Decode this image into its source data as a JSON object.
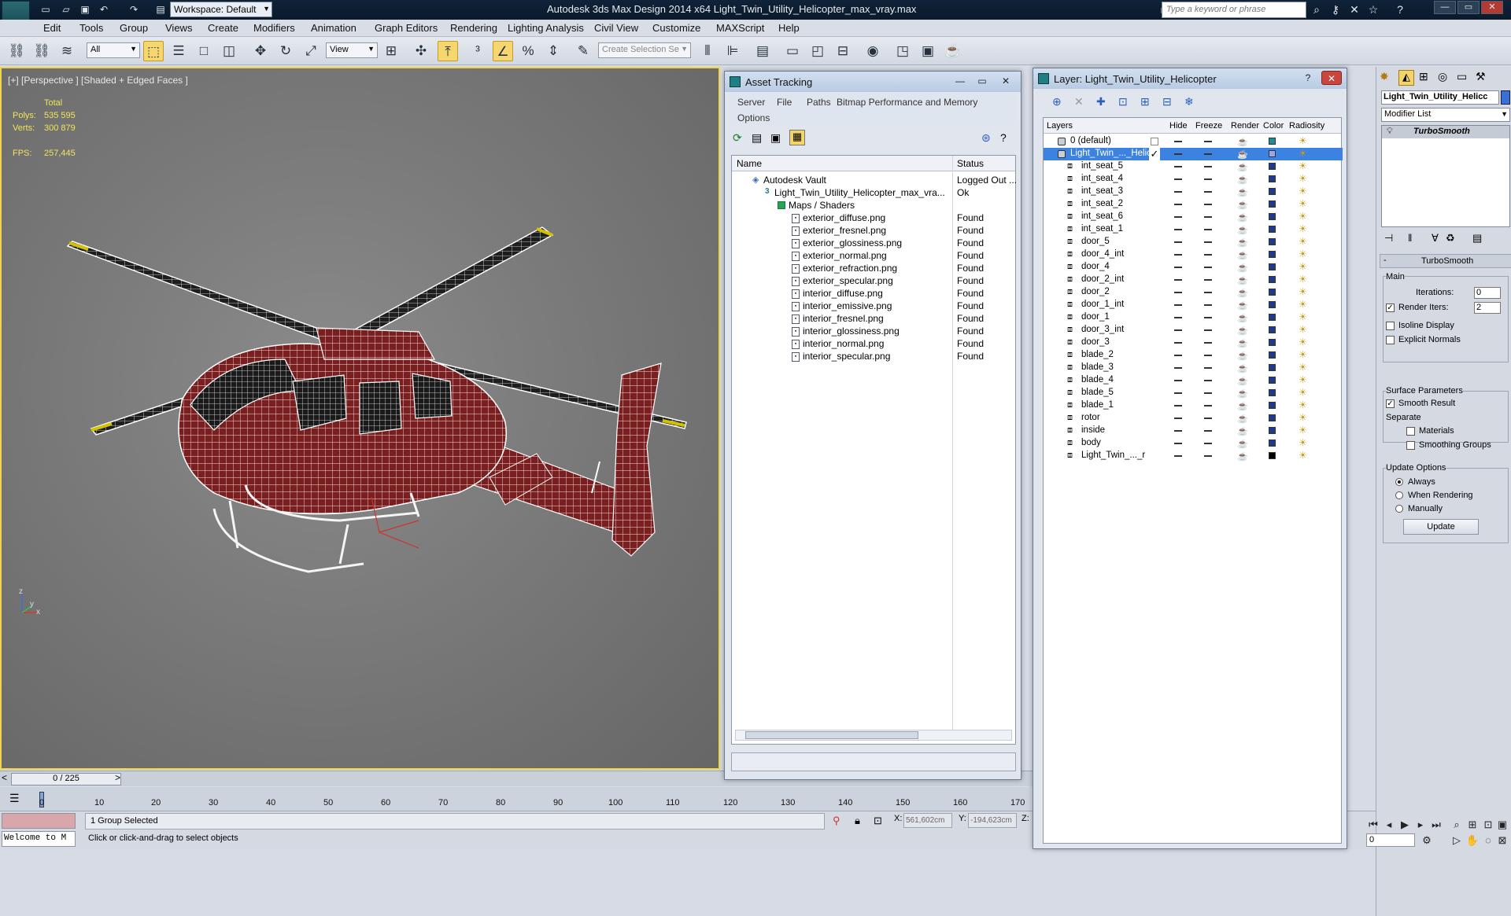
{
  "titlebar": {
    "logo_text": "MXD",
    "workspace": "Workspace: Default",
    "app_title": "Autodesk 3ds Max Design 2014 x64     Light_Twin_Utility_Helicopter_max_vray.max",
    "search_placeholder": "Type a keyword or phrase"
  },
  "menu": [
    "Edit",
    "Tools",
    "Group",
    "Views",
    "Create",
    "Modifiers",
    "Animation",
    "Graph Editors",
    "Rendering",
    "Lighting Analysis",
    "Civil View",
    "Customize",
    "MAXScript",
    "Help"
  ],
  "toolbar": {
    "filter": "All",
    "ref_coord": "View",
    "selection_set_placeholder": "Create Selection Se"
  },
  "viewport": {
    "label": "[+] [Perspective ] [Shaded + Edged Faces ]",
    "stats_header": "Total",
    "polys_label": "Polys:",
    "polys_value": "535 595",
    "verts_label": "Verts:",
    "verts_value": "300 879",
    "fps_label": "FPS:",
    "fps_value": "257,445",
    "axis_z": "z",
    "axis_x": "x",
    "axis_y": "y"
  },
  "timeline": {
    "frame": "0 / 225",
    "ticks": [
      "0",
      "10",
      "20",
      "30",
      "40",
      "50",
      "60",
      "70",
      "80",
      "90",
      "100",
      "110",
      "120",
      "130",
      "140",
      "150",
      "160",
      "170"
    ]
  },
  "status": {
    "listener_text": "Welcome to M",
    "selected": "1 Group Selected",
    "prompt": "Click or click-and-drag to select objects",
    "x_label": "X:",
    "x_value": "561,602cm",
    "y_label": "Y:",
    "y_value": "-194,623cm",
    "z_label": "Z:",
    "frame_input": "0"
  },
  "asset_tracking": {
    "title": "Asset Tracking",
    "menu": [
      "Server",
      "File",
      "Paths",
      "Bitmap Performance and Memory",
      "Options"
    ],
    "col_name": "Name",
    "col_status": "Status",
    "vault": {
      "name": "Autodesk Vault",
      "status": "Logged Out ..."
    },
    "scene_file": {
      "name": "Light_Twin_Utility_Helicopter_max_vra...",
      "status": "Ok"
    },
    "maps_folder": "Maps / Shaders",
    "files": [
      {
        "name": "exterior_diffuse.png",
        "status": "Found"
      },
      {
        "name": "exterior_fresnel.png",
        "status": "Found"
      },
      {
        "name": "exterior_glossiness.png",
        "status": "Found"
      },
      {
        "name": "exterior_normal.png",
        "status": "Found"
      },
      {
        "name": "exterior_refraction.png",
        "status": "Found"
      },
      {
        "name": "exterior_specular.png",
        "status": "Found"
      },
      {
        "name": "interior_diffuse.png",
        "status": "Found"
      },
      {
        "name": "interior_emissive.png",
        "status": "Found"
      },
      {
        "name": "interior_fresnel.png",
        "status": "Found"
      },
      {
        "name": "interior_glossiness.png",
        "status": "Found"
      },
      {
        "name": "interior_normal.png",
        "status": "Found"
      },
      {
        "name": "interior_specular.png",
        "status": "Found"
      }
    ]
  },
  "layers": {
    "title": "Layer: Light_Twin_Utility_Helicopter",
    "columns": [
      "Layers",
      "Hide",
      "Freeze",
      "Render",
      "Color",
      "Radiosity"
    ],
    "default_layer": "0 (default)",
    "active_layer": "Light_Twin_..._Helic",
    "items": [
      {
        "name": "int_seat_5",
        "color": "#1a3c8c"
      },
      {
        "name": "int_seat_4",
        "color": "#1a3c8c"
      },
      {
        "name": "int_seat_3",
        "color": "#1a3c8c"
      },
      {
        "name": "int_seat_2",
        "color": "#1a3c8c"
      },
      {
        "name": "int_seat_6",
        "color": "#1a3c8c"
      },
      {
        "name": "int_seat_1",
        "color": "#1a3c8c"
      },
      {
        "name": "door_5",
        "color": "#1a3c8c"
      },
      {
        "name": "door_4_int",
        "color": "#1a3c8c"
      },
      {
        "name": "door_4",
        "color": "#1a3c8c"
      },
      {
        "name": "door_2_int",
        "color": "#1a3c8c"
      },
      {
        "name": "door_2",
        "color": "#1a3c8c"
      },
      {
        "name": "door_1_int",
        "color": "#1a3c8c"
      },
      {
        "name": "door_1",
        "color": "#1a3c8c"
      },
      {
        "name": "door_3_int",
        "color": "#1a3c8c"
      },
      {
        "name": "door_3",
        "color": "#1a3c8c"
      },
      {
        "name": "blade_2",
        "color": "#1a3c8c"
      },
      {
        "name": "blade_3",
        "color": "#1a3c8c"
      },
      {
        "name": "blade_4",
        "color": "#1a3c8c"
      },
      {
        "name": "blade_5",
        "color": "#1a3c8c"
      },
      {
        "name": "blade_1",
        "color": "#1a3c8c"
      },
      {
        "name": "rotor",
        "color": "#1a3c8c"
      },
      {
        "name": "inside",
        "color": "#1a3c8c"
      },
      {
        "name": "body",
        "color": "#1a3c8c"
      },
      {
        "name": "Light_Twin_..._r",
        "color": "#000000"
      }
    ]
  },
  "command_panel": {
    "object_name": "Light_Twin_Utility_Helicc",
    "modifier_list": "Modifier List",
    "stack_item": "TurboSmooth",
    "rollout_title": "TurboSmooth",
    "main_label": "Main",
    "iterations_label": "Iterations:",
    "iterations_value": "0",
    "render_iters_label": "Render Iters:",
    "render_iters_value": "2",
    "isoline": "Isoline Display",
    "explicit_normals": "Explicit Normals",
    "surface_params": "Surface Parameters",
    "smooth_result": "Smooth Result",
    "separate": "Separate",
    "materials": "Materials",
    "smoothing_groups": "Smoothing Groups",
    "update_options": "Update Options",
    "always": "Always",
    "when_rendering": "When Rendering",
    "manually": "Manually",
    "update_button": "Update"
  }
}
